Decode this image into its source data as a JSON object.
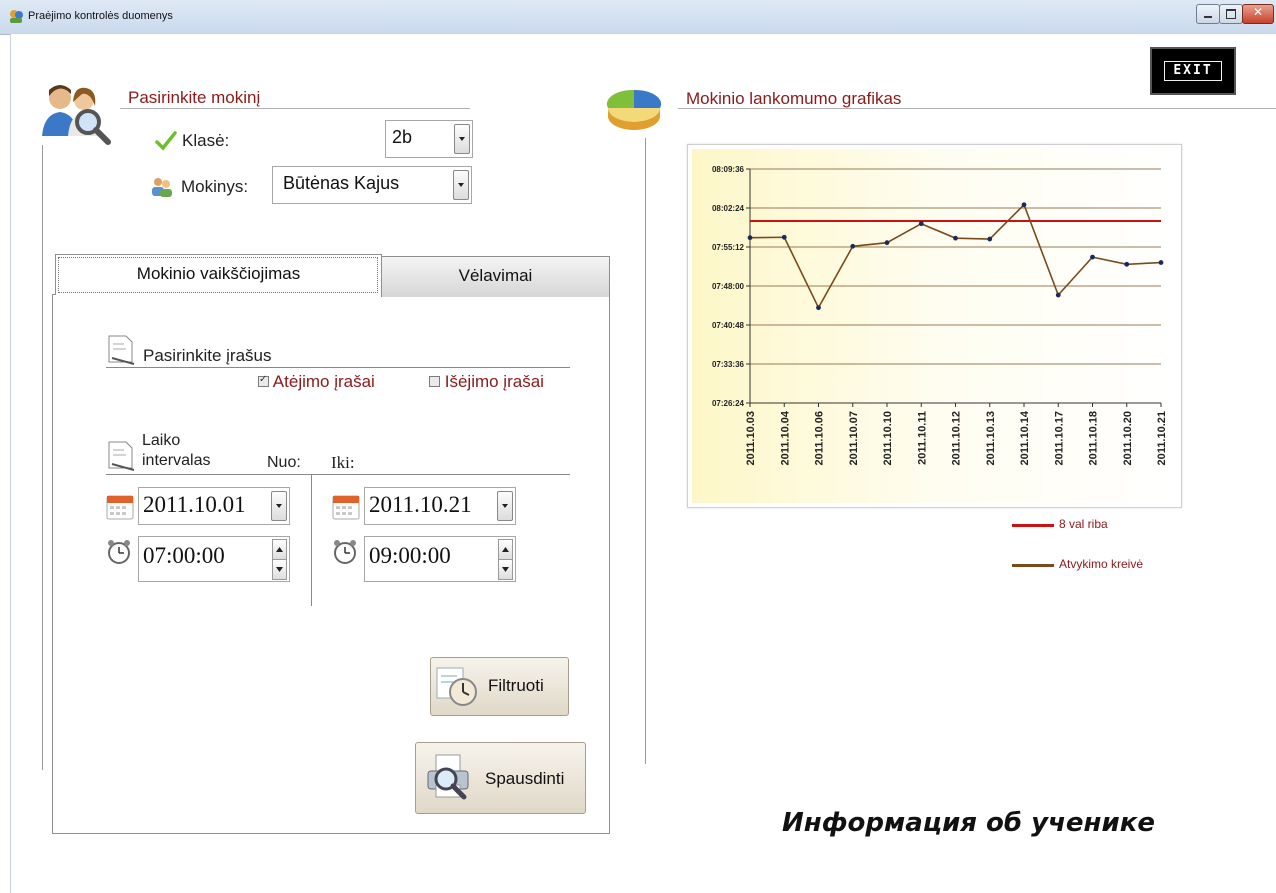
{
  "window": {
    "title": "Praėjimo kontrolės duomenys"
  },
  "student_select": {
    "title": "Pasirinkite mokinį",
    "class_label": "Klasė:",
    "class_value": "2b",
    "student_label": "Mokinys:",
    "student_value": "Būtėnas Kajus"
  },
  "tabs": [
    {
      "label": "Mokinio vaikščiojimas"
    },
    {
      "label": "Vėlavimai"
    }
  ],
  "records": {
    "title": "Pasirinkite įrašus",
    "arrivals_label": "Atėjimo įrašai",
    "arrivals_checked": true,
    "departures_label": "Išėjimo įrašai",
    "departures_checked": false
  },
  "interval": {
    "title_line1": "Laiko",
    "title_line2": "intervalas",
    "from_label": "Nuo:",
    "to_label": "Iki:",
    "from_date": "2011.10.01",
    "from_time": "07:00:00",
    "to_date": "2011.10.21",
    "to_time": "09:00:00"
  },
  "buttons": {
    "filter": "Filtruoti",
    "print": "Spausdinti",
    "exit": "EXIT"
  },
  "chart_section": {
    "title": "Mokinio lankomumo grafikas"
  },
  "caption": "Информация об ученике",
  "colors": {
    "accent": "#8b1a1a",
    "limit_line": "#cc1111",
    "curve": "#7a4a1a"
  },
  "chart_data": {
    "type": "line",
    "categories": [
      "2011.10.03",
      "2011.10.04",
      "2011.10.06",
      "2011.10.07",
      "2011.10.10",
      "2011.10.11",
      "2011.10.12",
      "2011.10.13",
      "2011.10.14",
      "2011.10.17",
      "2011.10.18",
      "2011.10.20",
      "2011.10.21"
    ],
    "y_ticks": [
      "08:09:36",
      "08:02:24",
      "07:55:12",
      "07:48:00",
      "07:40:48",
      "07:33:36",
      "07:26:24"
    ],
    "ylim": [
      "07:26:24",
      "08:09:36"
    ],
    "grid": true,
    "legend_position": "bottom-right",
    "series": [
      {
        "name": "8 val riba",
        "color": "#cc1111",
        "values": [
          "08:00:00",
          "08:00:00",
          "08:00:00",
          "08:00:00",
          "08:00:00",
          "08:00:00",
          "08:00:00",
          "08:00:00",
          "08:00:00",
          "08:00:00",
          "08:00:00",
          "08:00:00",
          "08:00:00"
        ]
      },
      {
        "name": "Atvykimo kreivė",
        "color": "#7a4a1a",
        "values": [
          "07:56:55",
          "07:57:00",
          "07:44:00",
          "07:55:20",
          "07:56:00",
          "07:59:30",
          "07:56:50",
          "07:56:40",
          "08:03:00",
          "07:46:20",
          "07:53:20",
          "07:52:00",
          "07:52:20"
        ]
      }
    ]
  }
}
